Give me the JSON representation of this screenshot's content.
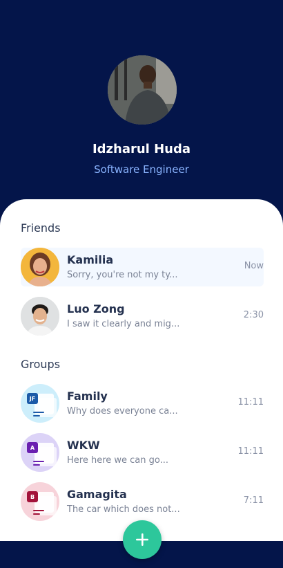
{
  "profile": {
    "name": "Idzharul Huda",
    "role": "Software Engineer"
  },
  "friends": {
    "title": "Friends",
    "items": [
      {
        "name": "Kamilia",
        "message": "Sorry, you're not my ty...",
        "time": "Now"
      },
      {
        "name": "Luo Zong",
        "message": "I saw it clearly and mig...",
        "time": "2:30"
      }
    ]
  },
  "groups": {
    "title": "Groups",
    "items": [
      {
        "name": "Family",
        "message": "Why does everyone ca...",
        "time": "11:11",
        "badge": "JF",
        "color": "#1b5aa8",
        "bg": "#cdeefb"
      },
      {
        "name": "WKW",
        "message": "Here here we can go...",
        "time": "11:11",
        "badge": "A",
        "color": "#6a1fb0",
        "bg": "#dcd3f7"
      },
      {
        "name": "Gamagita",
        "message": "The car which does not...",
        "time": "7:11",
        "badge": "B",
        "color": "#a3133a",
        "bg": "#f7d3da"
      }
    ]
  },
  "fab": {
    "icon": "plus-icon"
  }
}
